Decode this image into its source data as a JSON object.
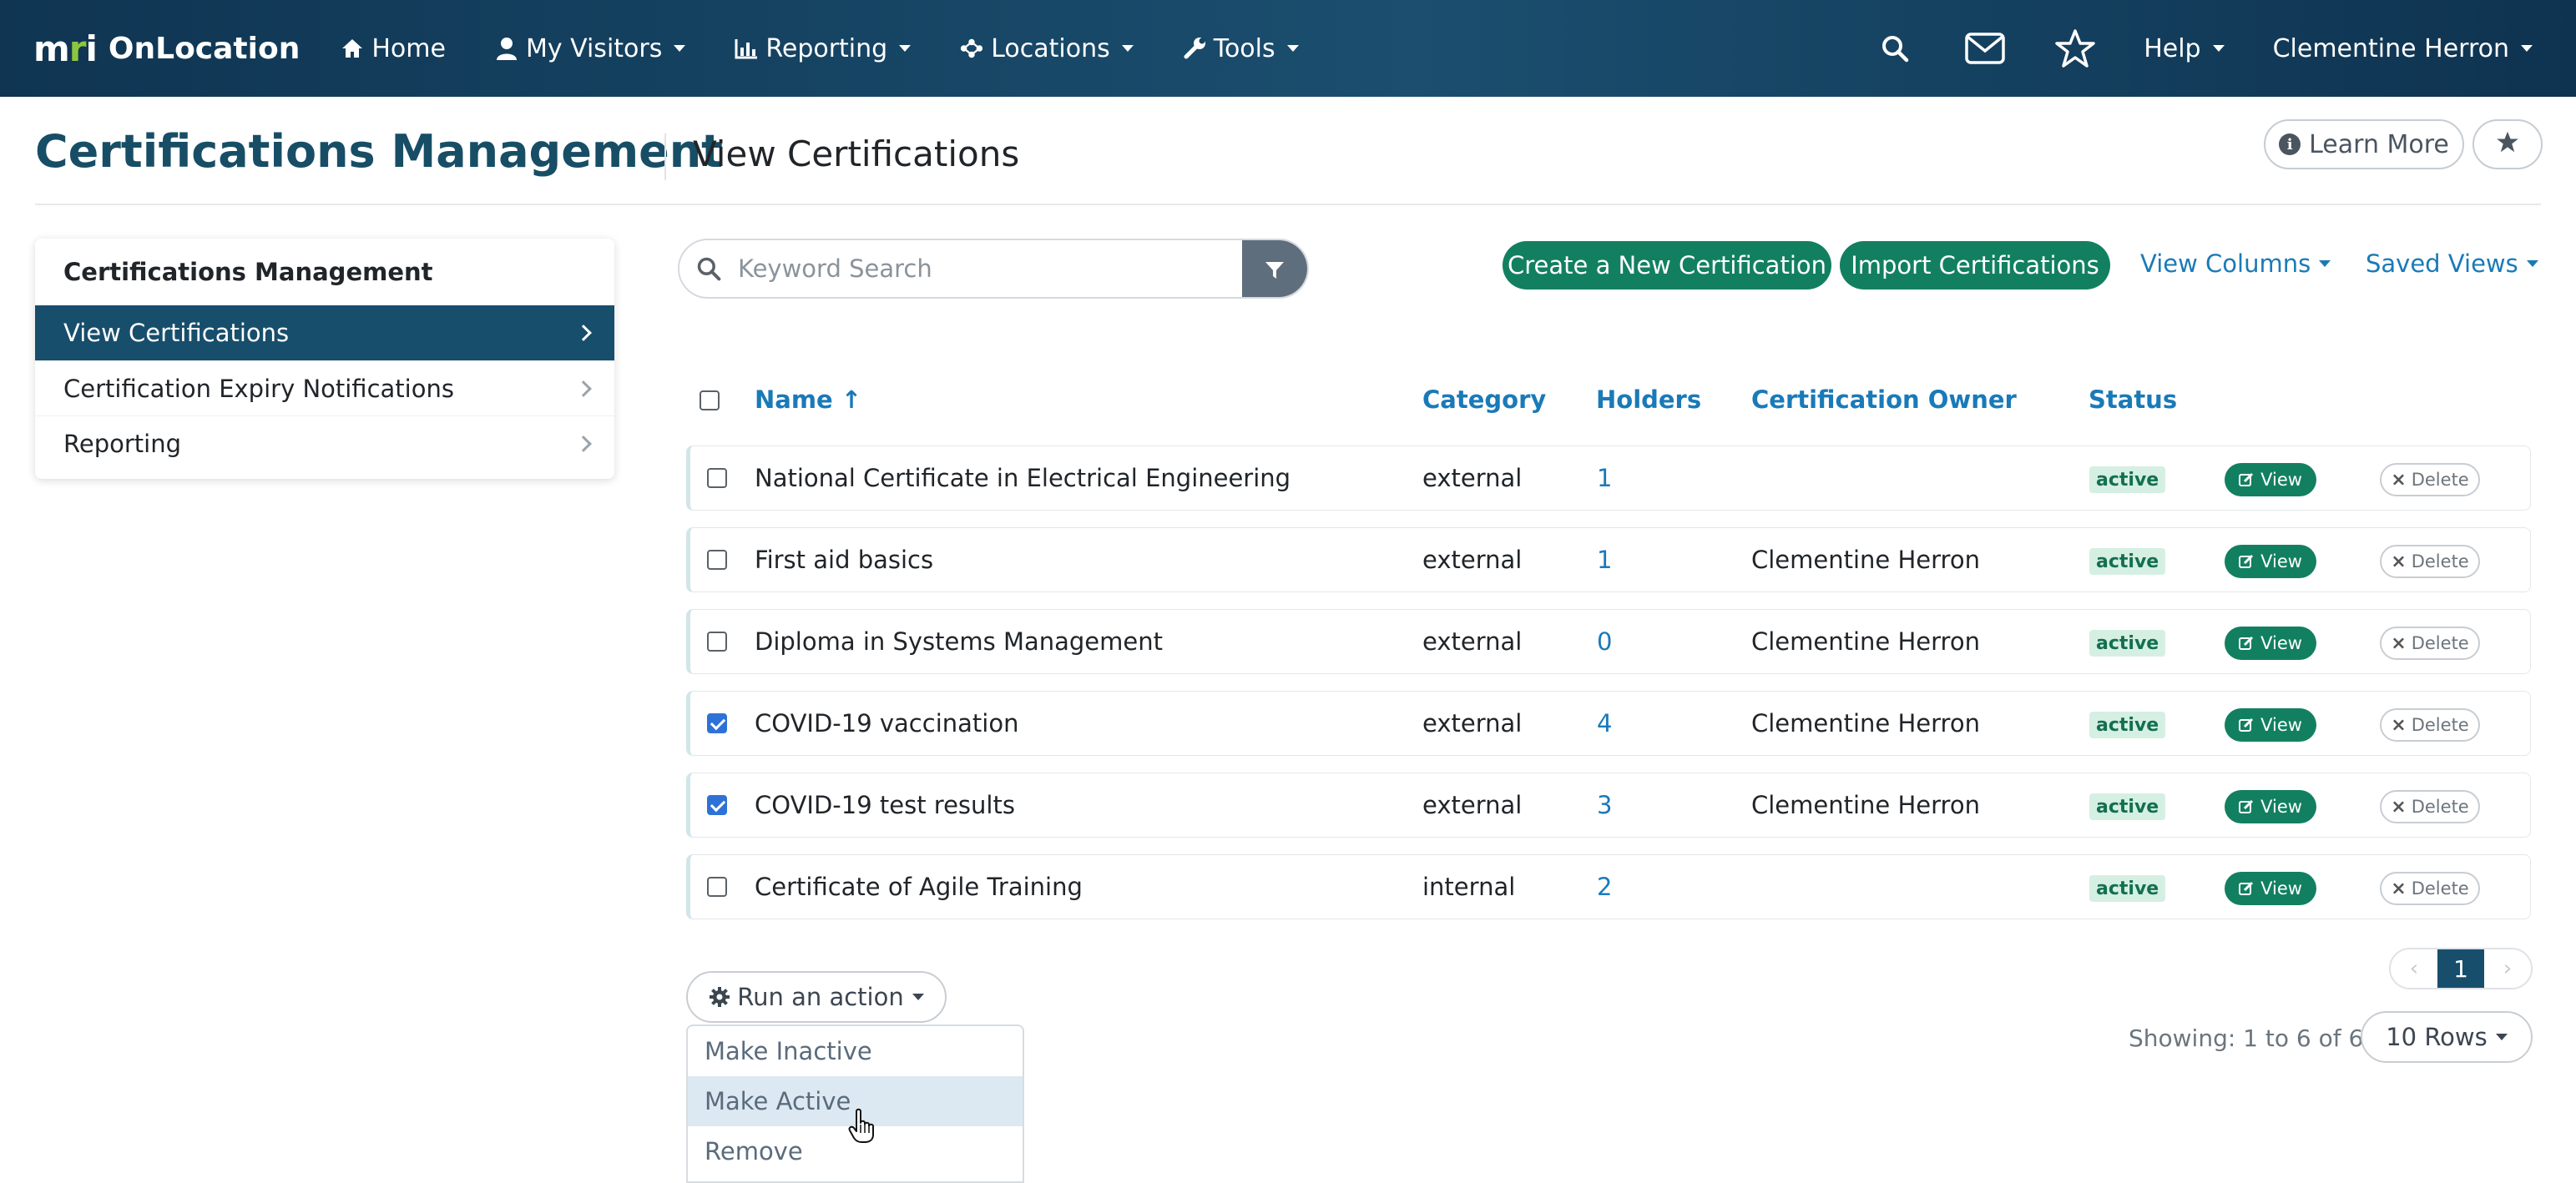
{
  "nav": {
    "logo": {
      "m": "m",
      "r": "r",
      "i": "i"
    },
    "brand": "OnLocation",
    "items": [
      {
        "label": "Home",
        "icon": "home-icon"
      },
      {
        "label": "My Visitors",
        "icon": "user-icon"
      },
      {
        "label": "Reporting",
        "icon": "bar-chart-icon"
      },
      {
        "label": "Locations",
        "icon": "network-icon"
      },
      {
        "label": "Tools",
        "icon": "wrench-icon"
      }
    ],
    "help": "Help",
    "user": "Clementine Herron"
  },
  "header": {
    "title": "Certifications Management",
    "subtitle": "View Certifications",
    "learn_more": "Learn More"
  },
  "sidebar": {
    "heading": "Certifications Management",
    "items": [
      {
        "label": "View Certifications",
        "active": true
      },
      {
        "label": "Certification Expiry Notifications",
        "active": false
      },
      {
        "label": "Reporting",
        "active": false
      }
    ]
  },
  "toolbar": {
    "search_placeholder": "Keyword Search",
    "create_label": "Create a New Certification",
    "import_label": "Import Certifications",
    "view_columns": "View Columns",
    "saved_views": "Saved Views"
  },
  "table": {
    "columns": {
      "name": "Name ↑",
      "category": "Category",
      "holders": "Holders",
      "owner": "Certification Owner",
      "status": "Status"
    },
    "view_label": "View",
    "delete_label": "Delete",
    "rows": [
      {
        "checked": false,
        "name": "National Certificate in Electrical Engineering",
        "category": "external",
        "holders": "1",
        "owner": "",
        "status": "active"
      },
      {
        "checked": false,
        "name": "First aid basics",
        "category": "external",
        "holders": "1",
        "owner": "Clementine Herron",
        "status": "active"
      },
      {
        "checked": false,
        "name": "Diploma in Systems Management",
        "category": "external",
        "holders": "0",
        "owner": "Clementine Herron",
        "status": "active"
      },
      {
        "checked": true,
        "name": "COVID-19 vaccination",
        "category": "external",
        "holders": "4",
        "owner": "Clementine Herron",
        "status": "active"
      },
      {
        "checked": true,
        "name": "COVID-19 test results",
        "category": "external",
        "holders": "3",
        "owner": "Clementine Herron",
        "status": "active"
      },
      {
        "checked": false,
        "name": "Certificate of Agile Training",
        "category": "internal",
        "holders": "2",
        "owner": "",
        "status": "active"
      }
    ]
  },
  "actions": {
    "run_label": "Run an action",
    "menu": [
      {
        "label": "Make Inactive",
        "hover": false
      },
      {
        "label": "Make Active",
        "hover": true
      },
      {
        "label": "Remove",
        "hover": false
      }
    ]
  },
  "pagination": {
    "prev": "‹",
    "current": "1",
    "next": "›",
    "showing": "Showing: 1 to 6 of 6",
    "rows_label": "10 Rows"
  },
  "colors": {
    "navbar": "#0f3552",
    "title": "#174e66",
    "accent_green": "#128060",
    "link_blue": "#1a7ab8",
    "active_row": "#174e6c"
  }
}
